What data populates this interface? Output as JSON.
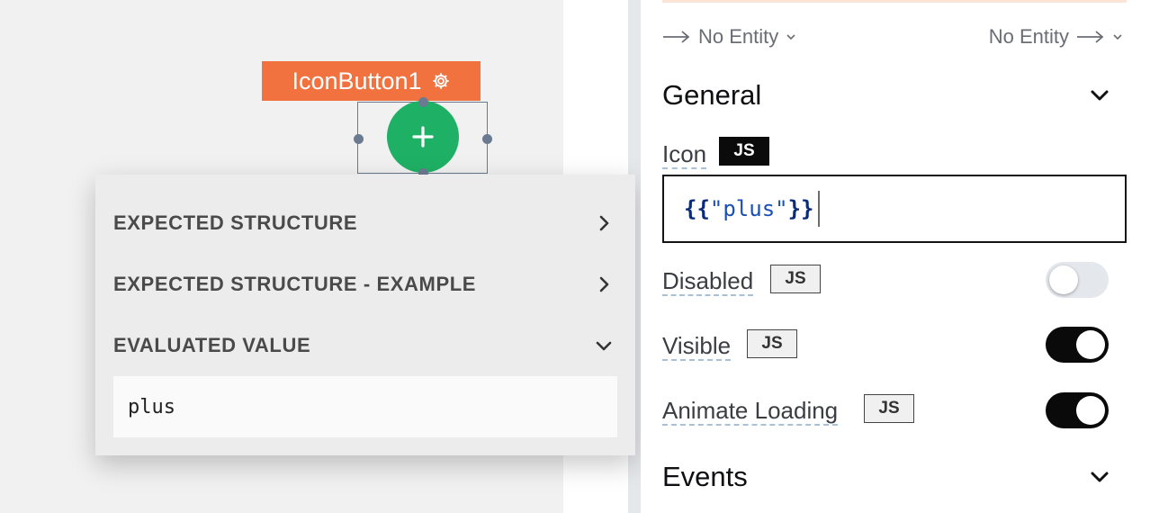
{
  "canvas": {
    "widget_label": "IconButton1",
    "widget_icon": "plus"
  },
  "popover": {
    "rows": [
      {
        "label": "EXPECTED STRUCTURE",
        "icon": "chevron-right-icon"
      },
      {
        "label": "EXPECTED STRUCTURE - EXAMPLE",
        "icon": "chevron-right-icon"
      },
      {
        "label": "EVALUATED VALUE",
        "icon": "chevron-down-icon"
      }
    ],
    "evaluated_value": "plus"
  },
  "pane": {
    "entity_left": "No Entity",
    "entity_right": "No Entity",
    "general": {
      "title": "General",
      "icon_label": "Icon",
      "js_label": "JS",
      "icon_code_open": "{{",
      "icon_code_value": "\"plus\"",
      "icon_code_close": "}}",
      "disabled_label": "Disabled",
      "disabled": false,
      "visible_label": "Visible",
      "visible": true,
      "animate_label": "Animate Loading",
      "animate": true
    },
    "events": {
      "title": "Events"
    }
  },
  "colors": {
    "accent": "#f1723f",
    "button_green": "#1eb165",
    "toggle_on": "#0a0a0a"
  }
}
